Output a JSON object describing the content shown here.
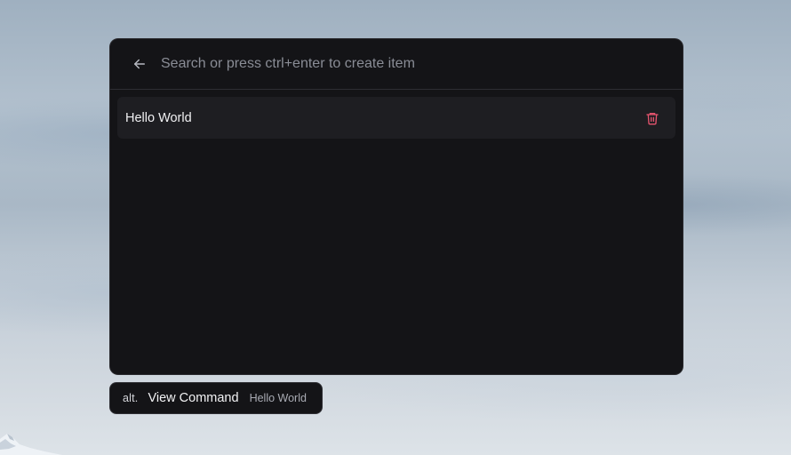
{
  "search": {
    "placeholder": "Search or press ctrl+enter to create item",
    "value": ""
  },
  "list": {
    "items": [
      {
        "label": "Hello World"
      }
    ]
  },
  "hint": {
    "key": "alt.",
    "action": "View Command",
    "target": "Hello World"
  },
  "colors": {
    "panel_bg": "#141417",
    "item_bg": "#1e1e22",
    "delete_icon": "#e5546e",
    "placeholder": "#8a8d96"
  },
  "icons": {
    "back": "arrow-left-icon",
    "delete": "trash-icon"
  }
}
